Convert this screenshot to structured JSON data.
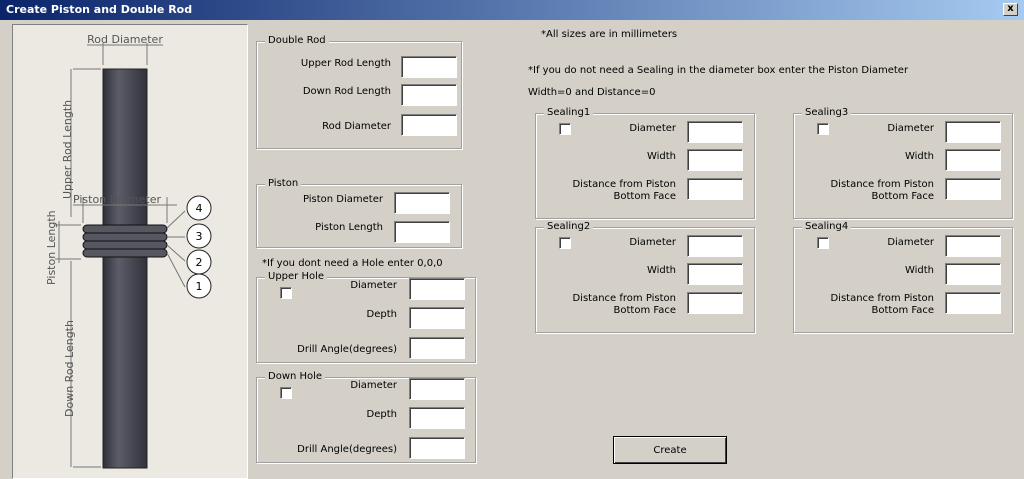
{
  "window": {
    "title": "Create Piston and Double Rod",
    "close_label": "x"
  },
  "drawing": {
    "rod_diameter": "Rod Diameter",
    "upper_rod_length": "Upper Rod Length",
    "piston_diameter": "Piston Diameter",
    "piston_length": "Piston Length",
    "down_rod_length": "Down Rod Length",
    "callouts": [
      "4",
      "3",
      "2",
      "1"
    ]
  },
  "notes": {
    "sizes": "*All sizes are in millimeters",
    "sealing": "*If you do not need a Sealing in the diameter box enter the Piston Diameter",
    "sealing_2": "Width=0 and Distance=0",
    "hole": "*If you dont need a Hole enter 0,0,0"
  },
  "double_rod": {
    "title": "Double Rod",
    "upper_rod_length": "Upper Rod Length",
    "down_rod_length": "Down Rod Length",
    "rod_diameter": "Rod Diameter"
  },
  "piston": {
    "title": "Piston",
    "diameter": "Piston Diameter",
    "length": "Piston Length"
  },
  "upper_hole": {
    "title": "Upper Hole",
    "diameter": "Diameter",
    "depth": "Depth",
    "drill_angle": "Drill Angle(degrees)"
  },
  "down_hole": {
    "title": "Down Hole",
    "diameter": "Diameter",
    "depth": "Depth",
    "drill_angle": "Drill Angle(degrees)"
  },
  "sealings": [
    {
      "title": "Sealing1",
      "diameter": "Diameter",
      "width": "Width",
      "distance_1": "Distance from Piston",
      "distance_2": "Bottom Face"
    },
    {
      "title": "Sealing2",
      "diameter": "Diameter",
      "width": "Width",
      "distance_1": "Distance from Piston",
      "distance_2": "Bottom Face"
    },
    {
      "title": "Sealing3",
      "diameter": "Diameter",
      "width": "Width",
      "distance_1": "Distance from Piston",
      "distance_2": "Bottom Face"
    },
    {
      "title": "Sealing4",
      "diameter": "Diameter",
      "width": "Width",
      "distance_1": "Distance from Piston",
      "distance_2": "Bottom Face"
    }
  ],
  "create_button": "Create",
  "colors": {
    "title_bar": "#0a246a",
    "window_bg": "#d4d0c8",
    "rod": "#4e4f5b"
  }
}
